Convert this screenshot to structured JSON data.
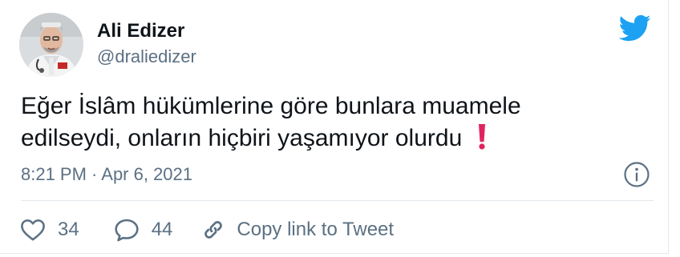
{
  "author": {
    "name": "Ali Edizer",
    "handle": "@draliedizer"
  },
  "tweet": {
    "line1": "Eğer İslâm hükümlerine göre bunlara muamele",
    "line2": "edilseydi, onların hiçbiri yaşamıyor olurdu"
  },
  "meta": {
    "timestamp": "8:21 PM · Apr 6, 2021"
  },
  "actions": {
    "likes": "34",
    "replies": "44",
    "copy_link_label": "Copy link to Tweet"
  },
  "colors": {
    "brand_blue": "#1da1f2",
    "muted_text": "#5b7083",
    "exclamation_red": "#e0245e"
  },
  "icons": {
    "brand": "twitter-bird-icon",
    "info": "info-icon",
    "like": "heart-icon",
    "reply": "speech-bubble-icon",
    "copy": "link-icon",
    "emoji": "red-exclamation-icon"
  }
}
